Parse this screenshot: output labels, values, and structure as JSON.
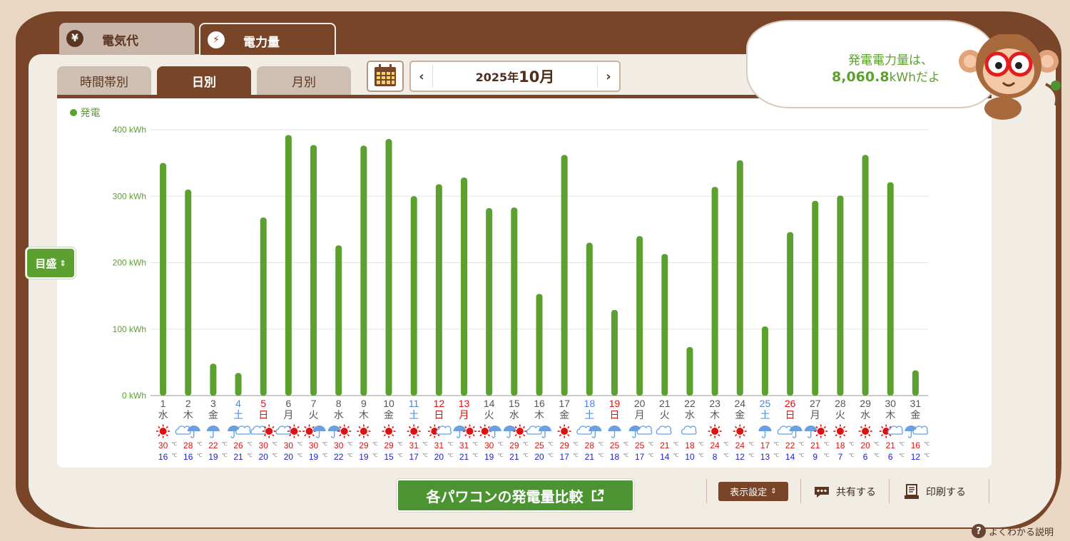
{
  "tabs": {
    "main": [
      {
        "label": "電気代",
        "icon": "yen-icon",
        "glyph": "¥"
      },
      {
        "label": "電力量",
        "icon": "lightning-icon",
        "glyph": "⚡"
      }
    ],
    "sub": [
      "時間帯別",
      "日別",
      "月別"
    ]
  },
  "period": {
    "year": "2025年",
    "month": "10月",
    "prev_glyph": "‹",
    "next_glyph": "›"
  },
  "summary": {
    "line1": "発電電力量は、",
    "value": "8,060.8",
    "suffix": "kWhだよ"
  },
  "legend": {
    "label": "発電"
  },
  "controls": {
    "scale_label": "目盛",
    "scale_glyph": "⇕",
    "compare_label": "各パワコンの発電量比較",
    "display_settings": "表示設定",
    "share": "共有する",
    "print": "印刷する",
    "help": "よくわかる説明",
    "help_glyph": "?"
  },
  "colors": {
    "bar": "#5ca02f",
    "weekday": "#555555",
    "saturday": "#4a86e0",
    "sunday_holiday": "#e01010",
    "temp_high": "#e01010",
    "temp_low": "#2020c8",
    "sun": "#e01010",
    "cloud": "#6aa0e0"
  },
  "chart_data": {
    "type": "bar",
    "series": [
      {
        "name": "発電",
        "values": [
          350,
          310,
          48,
          34,
          268,
          392,
          377,
          226,
          376,
          386,
          300,
          318,
          328,
          282,
          283,
          153,
          362,
          230,
          129,
          240,
          213,
          73,
          314,
          354,
          104,
          246,
          293,
          301,
          362,
          321,
          38
        ]
      }
    ],
    "categories": [
      "1",
      "2",
      "3",
      "4",
      "5",
      "6",
      "7",
      "8",
      "9",
      "10",
      "11",
      "12",
      "13",
      "14",
      "15",
      "16",
      "17",
      "18",
      "19",
      "20",
      "21",
      "22",
      "23",
      "24",
      "25",
      "26",
      "27",
      "28",
      "29",
      "30",
      "31"
    ],
    "weekdays": [
      "水",
      "木",
      "金",
      "土",
      "日",
      "月",
      "火",
      "水",
      "木",
      "金",
      "土",
      "日",
      "月",
      "火",
      "水",
      "木",
      "金",
      "土",
      "日",
      "月",
      "火",
      "水",
      "木",
      "金",
      "土",
      "日",
      "月",
      "火",
      "水",
      "木",
      "金"
    ],
    "day_types": [
      "w",
      "w",
      "w",
      "sat",
      "hol",
      "w",
      "w",
      "w",
      "w",
      "w",
      "sat",
      "hol",
      "hol",
      "w",
      "w",
      "w",
      "w",
      "sat",
      "hol",
      "w",
      "w",
      "w",
      "w",
      "w",
      "sat",
      "hol",
      "w",
      "w",
      "w",
      "w",
      "w"
    ],
    "weather": [
      [
        "sun"
      ],
      [
        "cloud",
        "rain"
      ],
      [
        "rain"
      ],
      [
        "rain",
        "cloud"
      ],
      [
        "cloud",
        "sun"
      ],
      [
        "cloud",
        "sun"
      ],
      [
        "sun",
        "rain"
      ],
      [
        "rain",
        "sun"
      ],
      [
        "sun"
      ],
      [
        "sun"
      ],
      [
        "sun"
      ],
      [
        "sun",
        "cloud"
      ],
      [
        "rain",
        "sun"
      ],
      [
        "sun",
        "rain"
      ],
      [
        "rain",
        "sun"
      ],
      [
        "cloud",
        "rain"
      ],
      [
        "sun"
      ],
      [
        "cloud",
        "rain"
      ],
      [
        "rain"
      ],
      [
        "rain",
        "cloud"
      ],
      [
        "cloud"
      ],
      [
        "cloud"
      ],
      [
        "sun"
      ],
      [
        "sun"
      ],
      [
        "rain"
      ],
      [
        "cloud",
        "rain"
      ],
      [
        "rain",
        "sun"
      ],
      [
        "sun"
      ],
      [
        "sun"
      ],
      [
        "sun",
        "cloud"
      ],
      [
        "rain",
        "cloud"
      ]
    ],
    "temp_high": [
      30,
      28,
      22,
      26,
      30,
      30,
      30,
      30,
      29,
      29,
      31,
      31,
      31,
      30,
      29,
      25,
      29,
      28,
      25,
      25,
      21,
      18,
      24,
      24,
      17,
      22,
      21,
      18,
      20,
      21,
      16
    ],
    "temp_low": [
      16,
      16,
      19,
      21,
      20,
      20,
      19,
      22,
      19,
      15,
      17,
      20,
      21,
      19,
      21,
      20,
      17,
      21,
      18,
      17,
      14,
      10,
      8,
      12,
      13,
      14,
      9,
      7,
      6,
      6,
      12
    ],
    "temp_unit": "℃",
    "yticks": [
      0,
      100,
      200,
      300,
      400
    ],
    "ytick_labels": [
      "0 kWh",
      "100 kWh",
      "200 kWh",
      "300 kWh",
      "400 kWh"
    ],
    "ylim": [
      0,
      400
    ],
    "grid": true,
    "legend_position": "top-left"
  }
}
